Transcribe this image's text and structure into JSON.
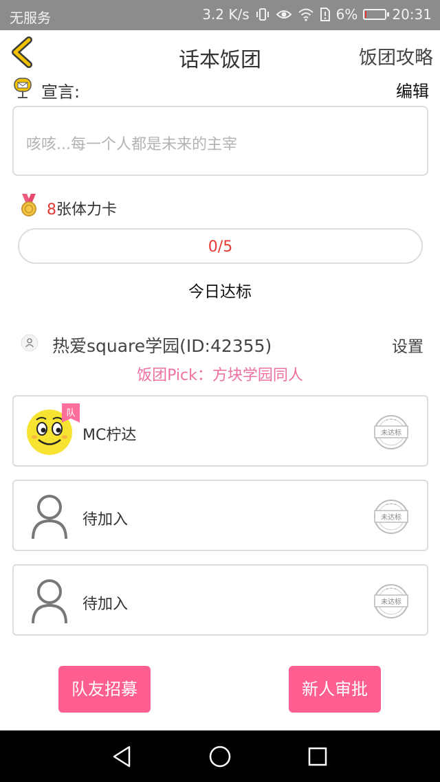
{
  "status_bar": {
    "carrier": "无服务",
    "speed": "3.2 K/s",
    "battery_percent": "6%",
    "battery_level": 0.06,
    "time": "20:31",
    "icons": [
      "vibrate-icon",
      "eye-icon",
      "wifi-icon",
      "sim-alert-icon",
      "battery-icon"
    ],
    "battery_color": "#e53935"
  },
  "header": {
    "back_icon": "chevron-left-icon",
    "title": "话本饭团",
    "guide_link": "饭团攻略"
  },
  "declaration": {
    "icon": "mailbox-icon",
    "label": "宣言:",
    "edit": "编辑",
    "placeholder": "咳咳...每一个人都是未来的主宰"
  },
  "stamina": {
    "icon": "medal-icon",
    "count": "8",
    "suffix": "张体力卡",
    "progress_text": "0/5",
    "progress_value": 0,
    "progress_max": 5,
    "today_label": "今日达标"
  },
  "group": {
    "icon": "group-avatar-icon",
    "name": "热爱square学园(ID:42355)",
    "settings": "设置",
    "pick": "饭团Pick：方块学园同人"
  },
  "members": [
    {
      "name": "MC柠达",
      "badge": "队",
      "status": "未达标",
      "avatar": "smiley-avatar"
    },
    {
      "name": "待加入",
      "status": "未达标",
      "avatar": "person-placeholder-icon"
    },
    {
      "name": "待加入",
      "status": "未达标",
      "avatar": "person-placeholder-icon"
    }
  ],
  "actions": {
    "recruit": "队友招募",
    "approve": "新人审批"
  },
  "colors": {
    "accent": "#ff5f90",
    "pick_text": "#ee6fa0",
    "highlight_red": "#e53935",
    "back_icon": "#f2c200"
  },
  "navbar": {
    "icons": [
      "back-triangle-icon",
      "home-circle-icon",
      "recents-square-icon"
    ]
  }
}
